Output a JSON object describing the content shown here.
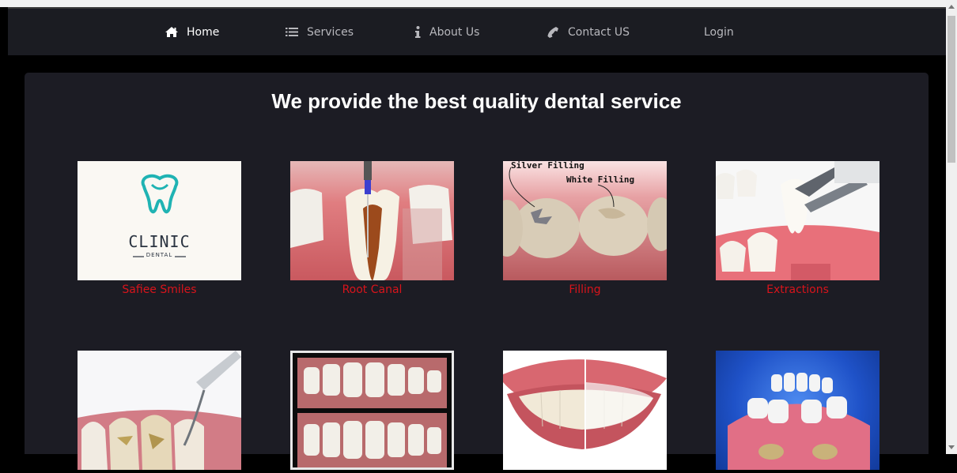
{
  "nav": {
    "items": [
      {
        "label": "Home",
        "icon": "home-icon",
        "active": true
      },
      {
        "label": "Services",
        "icon": "list-icon",
        "active": false
      },
      {
        "label": "About Us",
        "icon": "info-icon",
        "active": false
      },
      {
        "label": "Contact US",
        "icon": "phone-icon",
        "active": false
      },
      {
        "label": "Login",
        "icon": "",
        "active": false
      }
    ]
  },
  "main": {
    "title": "We provide the best quality dental service",
    "services": [
      {
        "label": "Safiee Smiles",
        "logo_text": "CLINIC",
        "logo_sub": "DENTAL"
      },
      {
        "label": "Root Canal"
      },
      {
        "label": "Filling",
        "annotation_1": "Silver Filling",
        "annotation_2": "White Filling"
      },
      {
        "label": "Extractions"
      },
      {
        "label": ""
      },
      {
        "label": ""
      },
      {
        "label": ""
      },
      {
        "label": ""
      }
    ]
  },
  "colors": {
    "nav_bg": "#1b1c22",
    "panel_bg": "#1c1c24",
    "label_red": "#d8141b",
    "logo_teal": "#1fb3b3"
  }
}
